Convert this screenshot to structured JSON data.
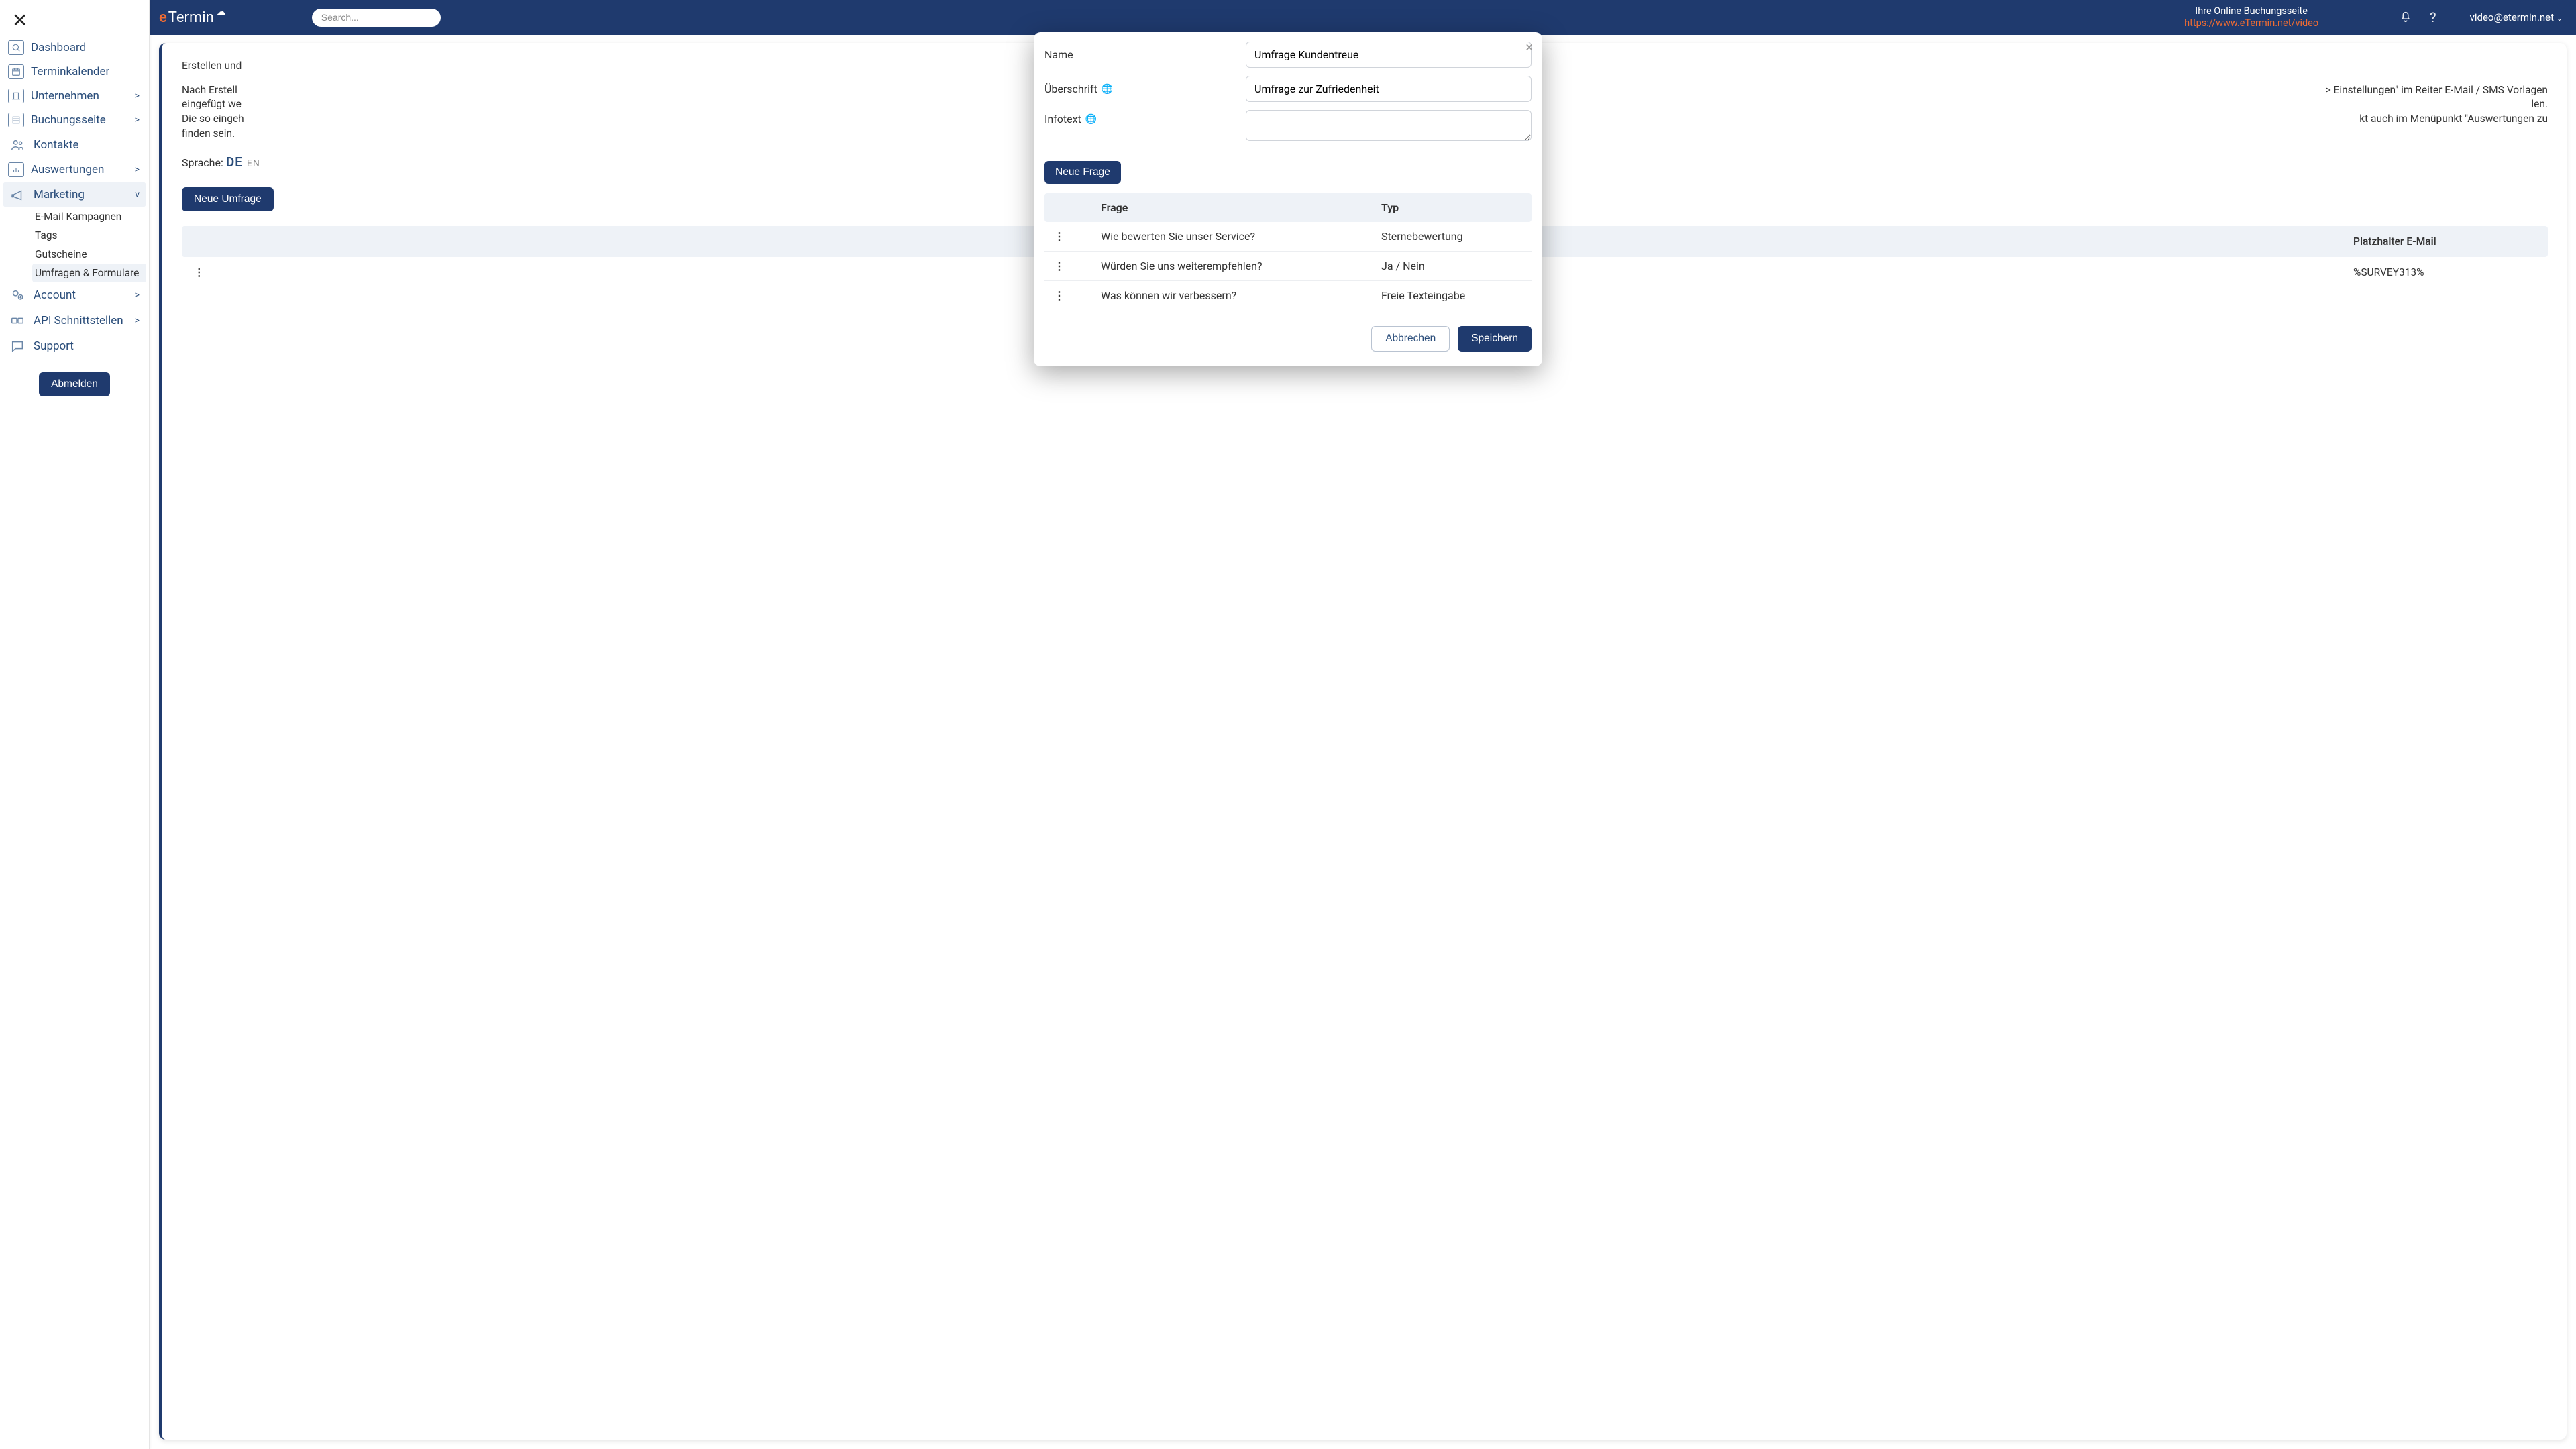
{
  "sidebar": {
    "items": [
      {
        "label": "Dashboard"
      },
      {
        "label": "Terminkalender"
      },
      {
        "label": "Unternehmen",
        "chev": ">"
      },
      {
        "label": "Buchungsseite",
        "chev": ">"
      },
      {
        "label": "Kontakte"
      },
      {
        "label": "Auswertungen",
        "chev": ">"
      },
      {
        "label": "Marketing",
        "chev": "v",
        "active": true,
        "children": [
          {
            "label": "E-Mail Kampagnen"
          },
          {
            "label": "Tags"
          },
          {
            "label": "Gutscheine"
          },
          {
            "label": "Umfragen & Formulare",
            "sel": true
          }
        ]
      },
      {
        "label": "Account",
        "chev": ">"
      },
      {
        "label": "API Schnittstellen",
        "chev": ">"
      },
      {
        "label": "Support"
      }
    ],
    "logout": "Abmelden"
  },
  "topbar": {
    "logo_e": "e",
    "logo_rest": "Termin",
    "search_placeholder": "Search...",
    "booking_title": "Ihre Online Buchungsseite",
    "booking_url": "https://www.eTermin.net/video",
    "user": "video@etermin.net"
  },
  "content": {
    "p1": "Erstellen und",
    "p2a": "Nach Erstell",
    "p2b": "eingefügt we",
    "p2c": "Die so eingeh",
    "p2d": "finden sein.",
    "p2_tail1": "> Einstellungen\" im Reiter E-Mail / SMS Vorlagen",
    "p2_tail2": "len.",
    "p2_tail3": "kt auch im Menüpunkt \"Auswertungen zu",
    "lang_label": "Sprache:",
    "lang_de": "DE",
    "lang_en": "EN",
    "new_survey": "Neue Umfrage",
    "table_head_placeholder": "Platzhalter E-Mail",
    "row_placeholder": "%SURVEY313%"
  },
  "modal": {
    "name_label": "Name",
    "name_value": "Umfrage Kundentreue",
    "heading_label": "Überschrift",
    "heading_value": "Umfrage zur Zufriedenheit",
    "infotext_label": "Infotext",
    "infotext_value": "",
    "new_question": "Neue Frage",
    "col_question": "Frage",
    "col_type": "Typ",
    "questions": [
      {
        "q": "Wie bewerten Sie unser Service?",
        "t": "Sternebewertung"
      },
      {
        "q": "Würden Sie uns weiterempfehlen?",
        "t": "Ja / Nein"
      },
      {
        "q": "Was können wir verbessern?",
        "t": "Freie Texteingabe"
      }
    ],
    "cancel": "Abbrechen",
    "save": "Speichern"
  }
}
